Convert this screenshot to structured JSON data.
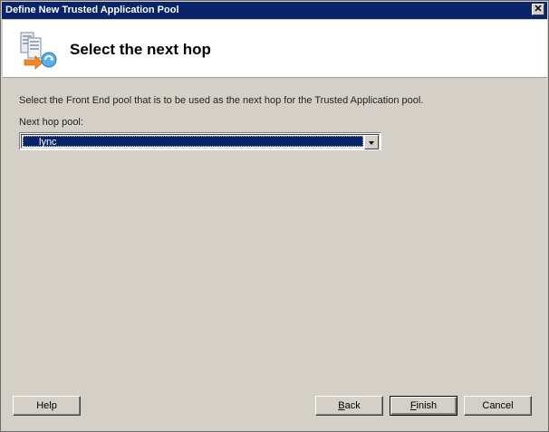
{
  "window": {
    "title": "Define New Trusted Application Pool",
    "close_glyph": "✕"
  },
  "header": {
    "icon": "pool-wizard-icon",
    "title": "Select the next hop"
  },
  "body": {
    "instruction": "Select the Front End pool that is to be used as the next hop for the Trusted Application pool.",
    "field_label": "Next hop pool:",
    "next_hop_pool": {
      "selected": "lync"
    }
  },
  "buttons": {
    "help": "Help",
    "back": {
      "mnemonic": "B",
      "rest": "ack"
    },
    "finish": {
      "mnemonic": "F",
      "rest": "inish"
    },
    "cancel": "Cancel"
  },
  "colors": {
    "titlebar": "#0a246a",
    "selection": "#0a246a",
    "dialog_face": "#d4d0c8"
  }
}
